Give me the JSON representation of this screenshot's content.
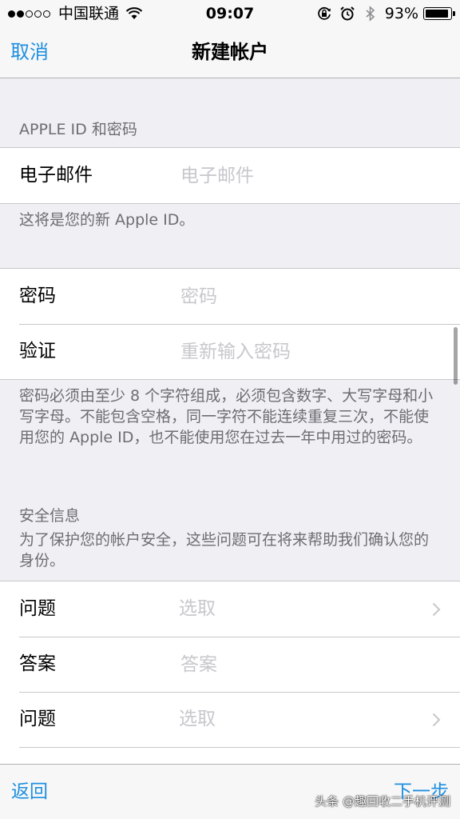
{
  "status_bar": {
    "carrier": "中国联通",
    "time": "09:07",
    "battery_percent": "93%",
    "battery_level": 0.93,
    "signal_bars_filled": 2,
    "signal_bars_total": 5
  },
  "nav": {
    "cancel_label": "取消",
    "title": "新建帐户"
  },
  "sections": {
    "apple_id_header": "APPLE ID 和密码",
    "email_label": "电子邮件",
    "email_placeholder": "电子邮件",
    "email_footer": "这将是您的新 Apple ID。",
    "password_label": "密码",
    "password_placeholder": "密码",
    "verify_label": "验证",
    "verify_placeholder": "重新输入密码",
    "password_footer": "密码必须由至少 8 个字符组成，必须包含数字、大写字母和小写字母。不能包含空格，同一字符不能连续重复三次，不能使用您的 Apple ID，也不能使用您在过去一年中用过的密码。",
    "security_header": "安全信息",
    "security_desc": "为了保护您的帐户安全，这些问题可在将来帮助我们确认您的身份。",
    "questions": [
      {
        "label": "问题",
        "value": "选取"
      },
      {
        "label": "答案",
        "placeholder": "答案"
      },
      {
        "label": "问题",
        "value": "选取"
      }
    ]
  },
  "toolbar": {
    "back_label": "返回",
    "next_label": "下一步"
  },
  "watermark": "头条 @趣回收二手机评测",
  "colors": {
    "accent": "#1d8fe0",
    "background": "#efeff4",
    "placeholder": "#c7c7cd",
    "secondary_text": "#6d6d72"
  }
}
